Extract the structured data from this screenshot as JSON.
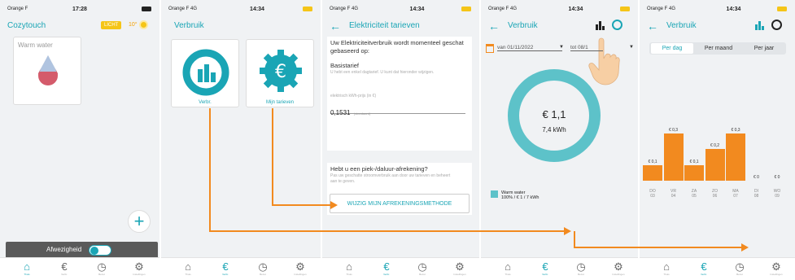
{
  "s1": {
    "carrier": "Orange F",
    "time": "17:28",
    "title": "Cozytouch",
    "badge": "LICHT",
    "temp": "10°",
    "card": "Warm water",
    "toggle": "Afwezigheid"
  },
  "s2": {
    "carrier": "Orange F 4G",
    "time": "14:34",
    "title": "Verbruik",
    "c1": "Verbr.",
    "c2": "Mijn tarieven"
  },
  "s3": {
    "carrier": "Orange F 4G",
    "time": "14:34",
    "title": "Elektriciteit tarieven",
    "intro": "Uw Elektriciteitverbruik wordt momenteel geschat gebaseerd op:",
    "tariff": "Basistarief",
    "tariff_desc": "U hebt een enkel dagtarief. U kunt dat hieronder wijzigen.",
    "field_label": "elektrisch kWh-prijs (in €)",
    "price": "0,1531",
    "price_note": "(standaard)",
    "q": "Hebt u een piek-/daluur-afrekening?",
    "q_desc": "Pas uw geschatte stroomverbruik aan door uw tarieven en beheert aan te geven.",
    "btn": "WIJZIG MIJN AFREKENINGSMETHODE"
  },
  "s4": {
    "carrier": "Orange F 4G",
    "time": "14:34",
    "title": "Verbruik",
    "from": "van 01/11/2022",
    "to": "tot 08/1",
    "total": "€ 1,1",
    "kwh": "7,4 kWh",
    "legend1": "Warm water",
    "legend2": "100% / € 1 / 7 kWh"
  },
  "s5": {
    "carrier": "Orange F 4G",
    "time": "14:34",
    "title": "Verbruik",
    "tabs": [
      "Per dag",
      "Per maand",
      "Per jaar"
    ]
  },
  "tabbar": {
    "home": "Thuis",
    "euro": "Verbr.",
    "clock": "Bezet",
    "gear": "Instellingen"
  },
  "chart_data": {
    "type": "bar",
    "categories": [
      "DO 03",
      "VR 04",
      "ZA 05",
      "ZO 06",
      "MA 07",
      "DI 08",
      "WO 09"
    ],
    "days": [
      "DO",
      "VR",
      "ZA",
      "ZO",
      "MA",
      "DI",
      "WO"
    ],
    "dates": [
      "03",
      "04",
      "05",
      "06",
      "07",
      "08",
      "09"
    ],
    "values": [
      0.1,
      0.3,
      0.1,
      0.2,
      0.3,
      0,
      0
    ],
    "value_labels": [
      "€ 0,1",
      "€ 0,3",
      "€ 0,1",
      "€ 0,2",
      "€ 0,3",
      "€ 0",
      "€ 0"
    ],
    "ylim": [
      0,
      0.35
    ],
    "color": "#f28a1f"
  },
  "colors": {
    "accent": "#1aa5b5",
    "orange": "#f28a1f",
    "badge": "#f5c518"
  }
}
